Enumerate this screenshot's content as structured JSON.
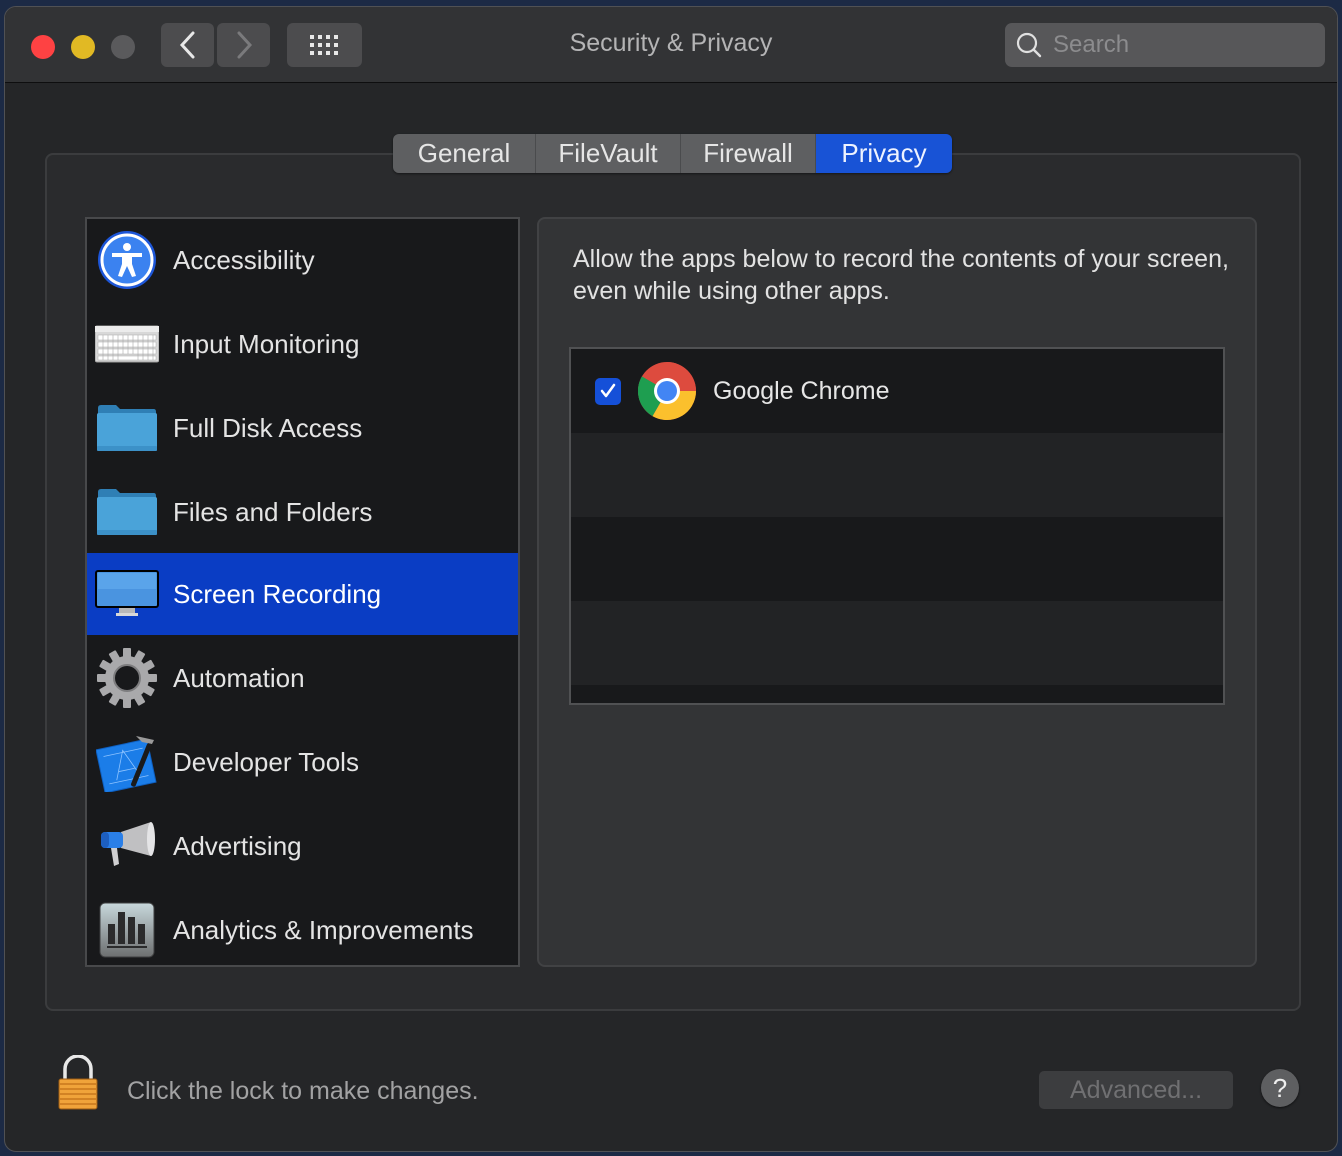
{
  "window": {
    "title": "Security & Privacy",
    "search_placeholder": "Search"
  },
  "toolbar": {
    "back_icon": "chevron-left-icon",
    "forward_icon": "chevron-right-icon",
    "show_all_icon": "grid-icon"
  },
  "tabs": [
    {
      "label": "General",
      "active": false
    },
    {
      "label": "FileVault",
      "active": false
    },
    {
      "label": "Firewall",
      "active": false
    },
    {
      "label": "Privacy",
      "active": true
    }
  ],
  "sidebar": {
    "items": [
      {
        "label": "Accessibility",
        "icon": "accessibility-icon",
        "selected": false
      },
      {
        "label": "Input Monitoring",
        "icon": "keyboard-icon",
        "selected": false
      },
      {
        "label": "Full Disk Access",
        "icon": "folder-icon",
        "selected": false
      },
      {
        "label": "Files and Folders",
        "icon": "folder-icon",
        "selected": false
      },
      {
        "label": "Screen Recording",
        "icon": "display-icon",
        "selected": true
      },
      {
        "label": "Automation",
        "icon": "gear-icon",
        "selected": false
      },
      {
        "label": "Developer Tools",
        "icon": "xcode-icon",
        "selected": false
      },
      {
        "label": "Advertising",
        "icon": "megaphone-icon",
        "selected": false
      },
      {
        "label": "Analytics & Improvements",
        "icon": "bar-chart-icon",
        "selected": false
      }
    ]
  },
  "detail": {
    "description": "Allow the apps below to record the contents of your screen, even while using other apps.",
    "apps": [
      {
        "name": "Google Chrome",
        "checked": true,
        "icon": "chrome-icon"
      }
    ]
  },
  "footer": {
    "lock_text": "Click the lock to make changes.",
    "advanced_label": "Advanced...",
    "help_label": "?"
  },
  "colors": {
    "accent": "#1853d6",
    "selection": "#0a3dc4",
    "close": "#fe4243",
    "minimize": "#e1b924"
  }
}
